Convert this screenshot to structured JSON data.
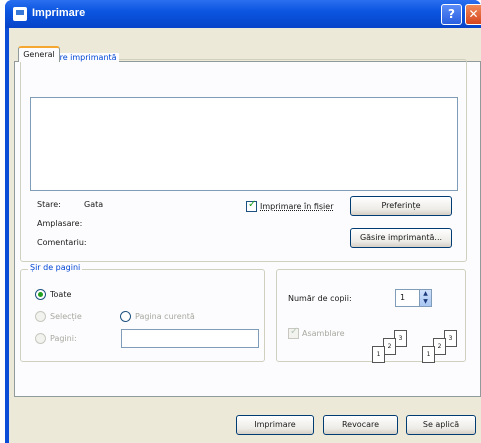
{
  "window": {
    "title": "Imprimare",
    "help_glyph": "?",
    "close_glyph": "✕"
  },
  "tabs": [
    {
      "label": "General"
    }
  ],
  "printer_group": {
    "label": "Selectare imprimantă",
    "status_label": "Stare:",
    "status_value": "Gata",
    "location_label": "Amplasare:",
    "comment_label": "Comentariu:",
    "print_to_file_label": "Imprimare în fișier",
    "print_to_file_checked": true,
    "preferences_button": "Preferințe",
    "find_printer_button": "Găsire imprimantă..."
  },
  "page_range_group": {
    "label": "Șir de pagini",
    "all_label": "Toate",
    "selection_label": "Selecție",
    "current_page_label": "Pagina curentă",
    "pages_label": "Pagini:",
    "pages_value": "",
    "selected": "all"
  },
  "copies_group": {
    "copies_label": "Număr de copii:",
    "copies_value": "1",
    "collate_label": "Asamblare",
    "collate_checked": true,
    "collate_sheet_numbers": [
      "1",
      "2",
      "3"
    ]
  },
  "footer": {
    "print_button": "Imprimare",
    "cancel_button": "Revocare",
    "apply_button": "Se aplică"
  },
  "colors": {
    "titlebar": "#0b55e0",
    "group_label": "#0046d5",
    "dialog_bg": "#ece9d8",
    "tab_highlight": "#f5a732"
  }
}
